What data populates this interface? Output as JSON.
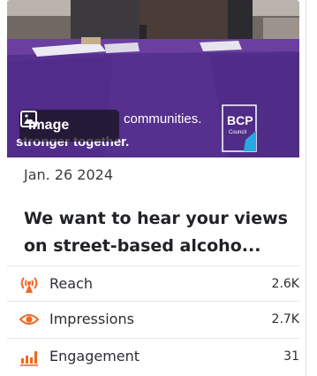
{
  "media": {
    "badge_label": "Image",
    "banner_line1": "communities.",
    "banner_line2": "stronger together.",
    "logo_text": "BCP",
    "logo_subtext": "Council"
  },
  "post": {
    "date": "Jan. 26 2024",
    "title": "We want to hear your views on street-based alcoho..."
  },
  "metrics": [
    {
      "label": "Reach",
      "value": "2.6K",
      "icon": "broadcast-icon"
    },
    {
      "label": "Impressions",
      "value": "2.7K",
      "icon": "eye-icon"
    },
    {
      "label": "Engagement",
      "value": "31",
      "icon": "bar-chart-icon"
    }
  ],
  "colors": {
    "accent": "#f26722",
    "banner_purple": "#5b2d91"
  }
}
